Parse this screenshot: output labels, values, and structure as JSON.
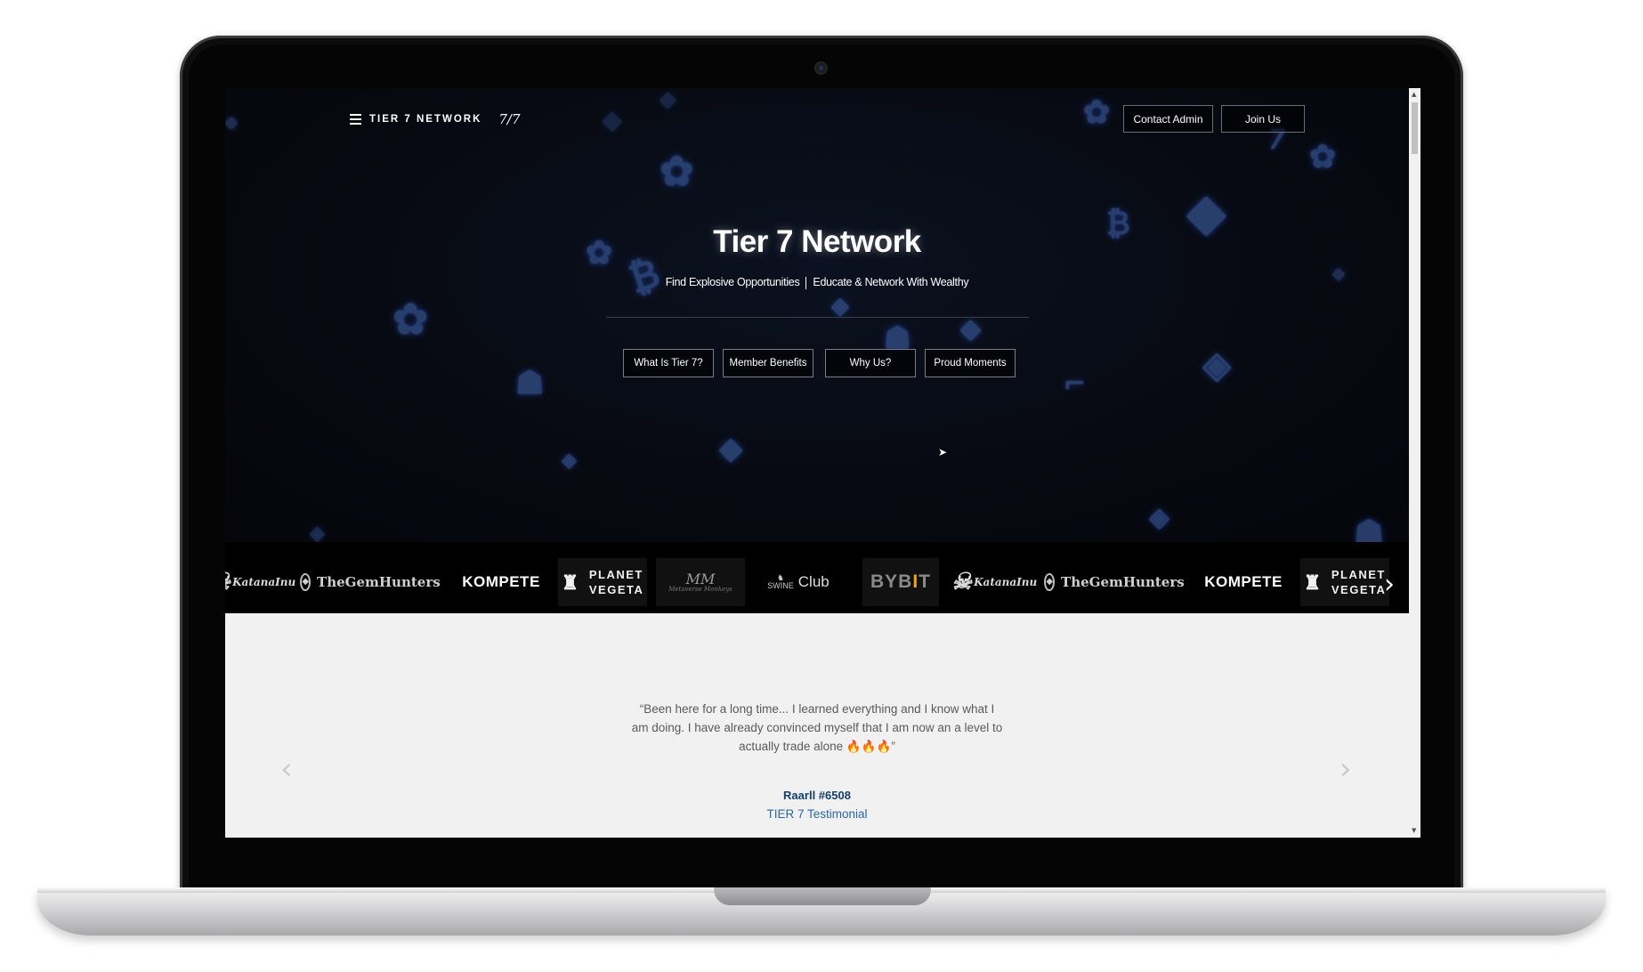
{
  "nav": {
    "brand": "TIER 7 NETWORK",
    "brand_logo": "7/7",
    "contact_label": "Contact Admin",
    "join_label": "Join Us"
  },
  "hero": {
    "title": "Tier 7 Network",
    "subtitle_left": "Find Explosive Opportunities",
    "subtitle_right": "Educate & Network With Wealthy",
    "buttons": [
      {
        "label": "What Is Tier 7?"
      },
      {
        "label": "Member Benefits"
      },
      {
        "label": "Why Us?"
      },
      {
        "label": "Proud Moments"
      }
    ]
  },
  "partners": {
    "items": [
      {
        "name": "Katana Inu",
        "label": "KatanaInu"
      },
      {
        "name": "The Gem Hunters",
        "label": "TheGemHunters"
      },
      {
        "name": "Kompete",
        "label": "KOMPETE"
      },
      {
        "name": "Planet Vegeta",
        "line1": "PLANET",
        "line2": "VEGETA"
      },
      {
        "name": "Metaverse Monkeys",
        "label": "MM",
        "small": "Metaverse Monkeys"
      },
      {
        "name": "Swine Club",
        "label": "Club",
        "small": "SWINE"
      },
      {
        "name": "Bybit",
        "pre": "BYB",
        "mid": "I",
        "post": "T"
      },
      {
        "name": "Katana Inu 2",
        "label": "KatanaInu"
      },
      {
        "name": "The Gem Hunters 2",
        "label": "TheGemHunters"
      },
      {
        "name": "Kompete 2",
        "label": "KOMPETE"
      },
      {
        "name": "Planet Vegeta 2",
        "line1": "PLANET",
        "line2": "VEGETA"
      }
    ],
    "next_icon": "chevron-right-icon"
  },
  "testimonial": {
    "quote": "“Been here for a long time... I learned everything and I know what I am doing. I have already convinced myself that I am now an a level to actually trade alone 🔥🔥🔥”",
    "author": "Raarll #6508",
    "role": "TIER 7 Testimonial",
    "prev_icon": "chevron-left-icon",
    "next_icon": "chevron-right-icon"
  },
  "colors": {
    "hero_bg": "#06080e",
    "accent_blue": "#2b5ad4",
    "testimonial_bg": "#f1f1f1",
    "author_color": "#153f6a",
    "role_color": "#2b67a6"
  }
}
